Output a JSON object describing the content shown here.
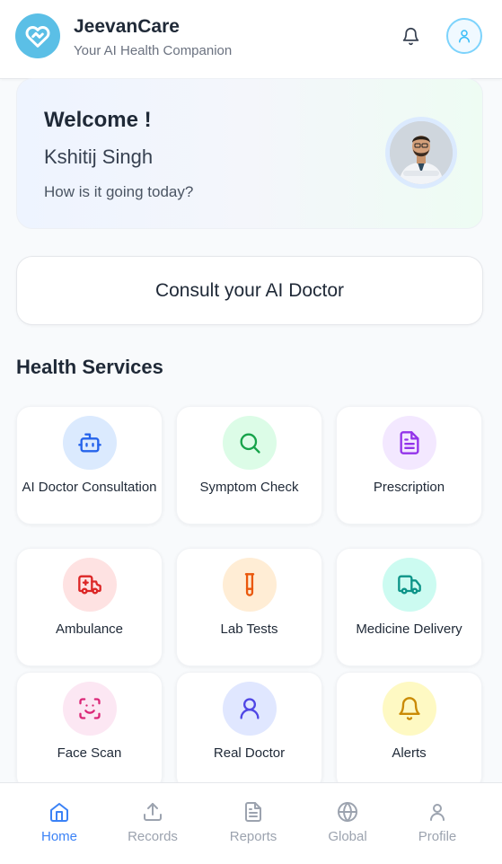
{
  "header": {
    "title": "JeevanCare",
    "subtitle": "Your AI Health Companion"
  },
  "welcome": {
    "title": "Welcome !",
    "name": "Kshitij Singh",
    "question": "How is it going today?"
  },
  "consult": {
    "label": "Consult your AI Doctor"
  },
  "services": {
    "title": "Health Services",
    "items": [
      {
        "label": "AI Doctor Consultation",
        "icon": "bot-icon",
        "color": "#2563eb",
        "bg": "#dbeafe"
      },
      {
        "label": "Symptom Check",
        "icon": "search-icon",
        "color": "#16a34a",
        "bg": "#dcfce7"
      },
      {
        "label": "Prescription",
        "icon": "file-text-icon",
        "color": "#9333ea",
        "bg": "#f3e8ff"
      },
      {
        "label": "Ambulance",
        "icon": "ambulance-icon",
        "color": "#dc2626",
        "bg": "#fee2e2"
      },
      {
        "label": "Lab Tests",
        "icon": "test-tube-icon",
        "color": "#ea580c",
        "bg": "#ffedd5"
      },
      {
        "label": "Medicine Delivery",
        "icon": "truck-icon",
        "color": "#0d9488",
        "bg": "#ccfbf1"
      },
      {
        "label": "Face Scan",
        "icon": "scan-face-icon",
        "color": "#db2777",
        "bg": "#fce7f3"
      },
      {
        "label": "Real Doctor",
        "icon": "user-icon",
        "color": "#4f46e5",
        "bg": "#e0e7ff"
      },
      {
        "label": "Alerts",
        "icon": "bell-icon",
        "color": "#ca8a04",
        "bg": "#fef9c3"
      }
    ]
  },
  "nav": {
    "items": [
      {
        "label": "Home",
        "icon": "home-icon",
        "active": true
      },
      {
        "label": "Records",
        "icon": "upload-icon",
        "active": false
      },
      {
        "label": "Reports",
        "icon": "file-text-icon",
        "active": false
      },
      {
        "label": "Global",
        "icon": "globe-icon",
        "active": false
      },
      {
        "label": "Profile",
        "icon": "user-icon",
        "active": false
      }
    ]
  },
  "colors": {
    "accent": "#3b82f6",
    "logo": "#5bbfe6",
    "inactive": "#9ca3af"
  }
}
